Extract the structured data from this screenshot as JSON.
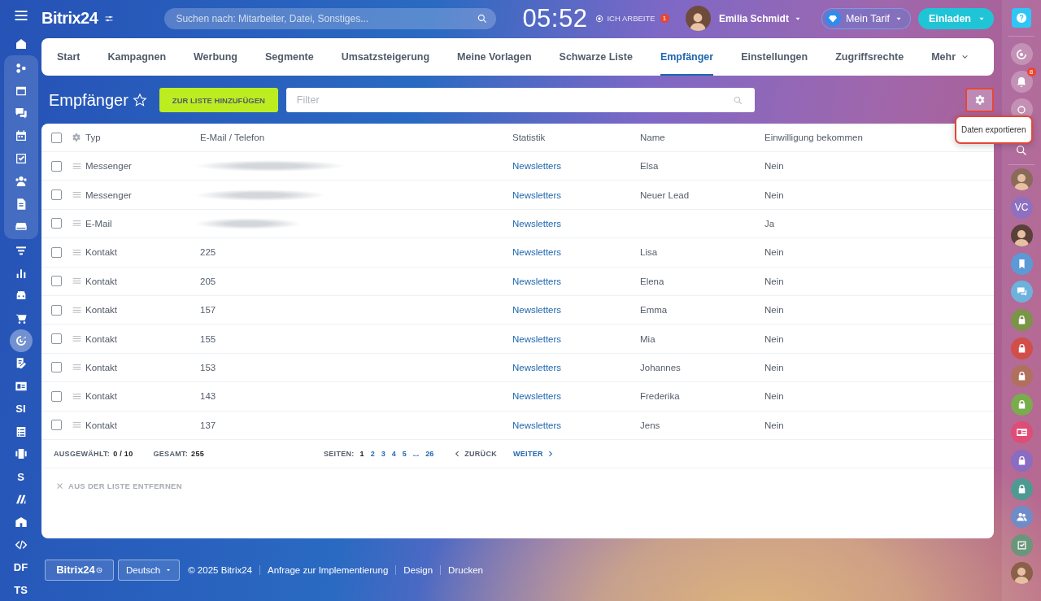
{
  "left_sidebar": {
    "items": [
      {
        "kind": "icon",
        "selected": false
      },
      {
        "kind": "group",
        "items": [
          {
            "kind": "icon",
            "selected": false
          },
          {
            "kind": "icon",
            "selected": false
          },
          {
            "kind": "icon",
            "selected": false
          },
          {
            "kind": "icon",
            "selected": false
          },
          {
            "kind": "icon",
            "selected": false
          },
          {
            "kind": "icon",
            "selected": false
          },
          {
            "kind": "icon",
            "selected": false
          },
          {
            "kind": "icon",
            "selected": false
          }
        ]
      },
      {
        "kind": "icon",
        "selected": false
      },
      {
        "kind": "icon",
        "selected": false
      },
      {
        "kind": "icon",
        "selected": false
      },
      {
        "kind": "icon",
        "selected": false
      },
      {
        "kind": "icon",
        "selected": true
      },
      {
        "kind": "icon",
        "selected": false
      },
      {
        "kind": "icon",
        "selected": false
      },
      {
        "kind": "text",
        "label": "SI",
        "selected": false
      },
      {
        "kind": "icon",
        "selected": false
      },
      {
        "kind": "icon",
        "selected": false
      },
      {
        "kind": "text",
        "label": "S",
        "selected": false
      },
      {
        "kind": "icon",
        "selected": false
      },
      {
        "kind": "icon",
        "selected": false
      },
      {
        "kind": "icon",
        "selected": false
      },
      {
        "kind": "text",
        "label": "DF",
        "selected": false
      },
      {
        "kind": "text",
        "label": "TS",
        "selected": false
      }
    ]
  },
  "top_bar": {
    "logo": "Bitrix24",
    "search": {
      "placeholder": "Suchen nach: Mitarbeiter, Datei, Sonstiges..."
    },
    "clock": "05:52",
    "work_status": {
      "label": "ICH ARBEITE",
      "badge": "1"
    },
    "user": {
      "name": "Emilia Schmidt"
    },
    "plan_button": "Mein Tarif",
    "invite_button": "Einladen"
  },
  "tabs": [
    {
      "label": "Start",
      "selected": false
    },
    {
      "label": "Kampagnen",
      "selected": false
    },
    {
      "label": "Werbung",
      "selected": false
    },
    {
      "label": "Segmente",
      "selected": false
    },
    {
      "label": "Umsatzsteigerung",
      "selected": false
    },
    {
      "label": "Meine Vorlagen",
      "selected": false
    },
    {
      "label": "Schwarze Liste",
      "selected": false
    },
    {
      "label": "Empfänger",
      "selected": true
    },
    {
      "label": "Einstellungen",
      "selected": false
    },
    {
      "label": "Zugriffsrechte",
      "selected": false
    },
    {
      "label": "Mehr",
      "selected": false
    }
  ],
  "page": {
    "title": "Empfänger",
    "add_button": "ZUR LISTE HINZUFÜGEN",
    "filter": {
      "placeholder": "Filter"
    },
    "settings_button": {
      "highlighted": true
    },
    "settings_menu": {
      "open": true,
      "highlighted": true,
      "items": [
        "Daten exportieren"
      ]
    }
  },
  "table": {
    "all_checked": false,
    "columns": [
      "Typ",
      "E-Mail / Telefon",
      "Statistik",
      "Name",
      "Einwilligung bekommen"
    ],
    "rows": [
      {
        "type": "Messenger",
        "contact_hidden": true,
        "statistics": "Newsletters",
        "name": "Elsa",
        "consent": "Nein",
        "checked": false
      },
      {
        "type": "Messenger",
        "contact_hidden": true,
        "statistics": "Newsletters",
        "name": "Neuer Lead",
        "consent": "Nein",
        "checked": false
      },
      {
        "type": "E-Mail",
        "contact_hidden": true,
        "statistics": "Newsletters",
        "consent": "Ja",
        "checked": false
      },
      {
        "type": "Kontakt",
        "contact_hidden": false,
        "contact": "225",
        "statistics": "Newsletters",
        "name": "Lisa",
        "consent": "Nein",
        "checked": false
      },
      {
        "type": "Kontakt",
        "contact_hidden": false,
        "contact": "205",
        "statistics": "Newsletters",
        "name": "Elena",
        "consent": "Nein",
        "checked": false
      },
      {
        "type": "Kontakt",
        "contact_hidden": false,
        "contact": "157",
        "statistics": "Newsletters",
        "name": "Emma",
        "consent": "Nein",
        "checked": false
      },
      {
        "type": "Kontakt",
        "contact_hidden": false,
        "contact": "155",
        "statistics": "Newsletters",
        "name": "Mia",
        "consent": "Nein",
        "checked": false
      },
      {
        "type": "Kontakt",
        "contact_hidden": false,
        "contact": "153",
        "statistics": "Newsletters",
        "name": "Johannes",
        "consent": "Nein",
        "checked": false
      },
      {
        "type": "Kontakt",
        "contact_hidden": false,
        "contact": "143",
        "statistics": "Newsletters",
        "name": "Frederika",
        "consent": "Nein",
        "checked": false
      },
      {
        "type": "Kontakt",
        "contact_hidden": false,
        "contact": "137",
        "statistics": "Newsletters",
        "name": "Jens",
        "consent": "Nein",
        "checked": false
      }
    ]
  },
  "pager": {
    "selected_label": "AUSGEWÄHLT:",
    "selected_value": "0 / 10",
    "total_label": "GESAMT:",
    "total_value": "255",
    "pages_label": "SEITEN:",
    "pages": [
      {
        "label": "1",
        "selected": true
      },
      {
        "label": "2",
        "selected": false
      },
      {
        "label": "3",
        "selected": false
      },
      {
        "label": "4",
        "selected": false
      },
      {
        "label": "5",
        "selected": false
      },
      {
        "label": "...",
        "selected": false
      },
      {
        "label": "26",
        "selected": false
      }
    ],
    "prev": {
      "label": "ZURÜCK",
      "disabled": true
    },
    "next": {
      "label": "WEITER",
      "disabled": false
    }
  },
  "actions": [
    {
      "label": "AUS DER LISTE ENTFERNEN",
      "disabled": true
    }
  ],
  "footer": {
    "brand_button": "Bitrix24",
    "language": "Deutsch",
    "copyright": "© 2025 Bitrix24",
    "links": [
      "Anfrage zur Implementierung",
      "Design",
      "Drucken"
    ]
  },
  "right_sidebar": {
    "items": [
      {
        "kind": "copilot"
      },
      {
        "kind": "bell",
        "badge": "8"
      },
      {
        "kind": "plain"
      },
      {
        "kind": "search"
      },
      {
        "kind": "photo",
        "color": "#8a6a58"
      },
      {
        "kind": "initials",
        "label": "VC",
        "color": "#8e70c0"
      },
      {
        "kind": "photo",
        "color": "#5a4038"
      },
      {
        "kind": "bookmark",
        "color": "#5b9ad6"
      },
      {
        "kind": "chat",
        "color": "#6cb2dc"
      },
      {
        "kind": "lock",
        "color": "#7a9448"
      },
      {
        "kind": "lock",
        "color": "#d24e4a"
      },
      {
        "kind": "lock",
        "color": "#b0705e"
      },
      {
        "kind": "lock",
        "color": "#78ac4c"
      },
      {
        "kind": "card",
        "color": "#df4c76"
      },
      {
        "kind": "lock",
        "color": "#8a6cc2"
      },
      {
        "kind": "lock",
        "color": "#4e9a92"
      },
      {
        "kind": "people",
        "color": "#6e8cc8"
      },
      {
        "kind": "task",
        "color": "#6a967c"
      },
      {
        "kind": "photo",
        "color": "#8a6048"
      }
    ]
  }
}
